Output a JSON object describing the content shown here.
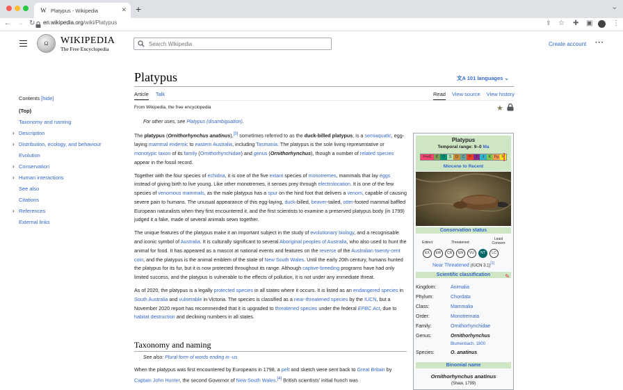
{
  "browser": {
    "tab_title": "Platypus - Wikipedia",
    "tab_favicon": "W",
    "url_host": "en.wikipedia.org",
    "url_path": "/wiki/Platypus"
  },
  "header": {
    "wordmark": "Wikipedia",
    "tagline": "The Free Encyclopedia",
    "search_placeholder": "Search Wikipedia",
    "create_account": "Create account"
  },
  "toc": {
    "title": "Contents",
    "hide": "[hide]",
    "items": [
      {
        "label": "(Top)",
        "expandable": false
      },
      {
        "label": "Taxonomy and naming",
        "expandable": false
      },
      {
        "label": "Description",
        "expandable": true
      },
      {
        "label": "Distribution, ecology, and behaviour",
        "expandable": true
      },
      {
        "label": "Evolution",
        "expandable": false
      },
      {
        "label": "Conservation",
        "expandable": true
      },
      {
        "label": "Human interactions",
        "expandable": true
      },
      {
        "label": "See also",
        "expandable": false
      },
      {
        "label": "Citations",
        "expandable": false
      },
      {
        "label": "References",
        "expandable": true
      },
      {
        "label": "External links",
        "expandable": false
      }
    ]
  },
  "article": {
    "title": "Platypus",
    "languages": "101 languages",
    "tab_article": "Article",
    "tab_talk": "Talk",
    "tab_read": "Read",
    "tab_view_source": "View source",
    "tab_view_history": "View history",
    "from": "From Wikipedia, the free encyclopedia",
    "hatnote_prefix": "For other uses, see ",
    "hatnote_link": "Platypus (disambiguation)",
    "hatnote_suffix": ".",
    "section1": "Taxonomy and naming",
    "see_also_prefix": "See also: ",
    "see_also_link": "Plural form of words ending in -us"
  },
  "infobox": {
    "name": "Platypus",
    "temporal_label": "Temporal range: 9–0",
    "temporal_unit": "Ma",
    "epochs": [
      "PreЄ",
      "Є",
      "O",
      "S",
      "D",
      "C",
      "P",
      "T",
      "J",
      "K",
      "Pg",
      "N"
    ],
    "epoch_colors": [
      "#f74370",
      "#7fa056",
      "#009270",
      "#b3e1b6",
      "#cb8c37",
      "#67a599",
      "#f04028",
      "#812b92",
      "#34b2c9",
      "#7fc64e",
      "#fd9a52",
      "#ffe619"
    ],
    "epoch_range": "Miocene to Recent",
    "conservation_status": "Conservation status",
    "status_extinct": "Extinct",
    "status_threatened": "Threatened",
    "status_least": "Least Concern",
    "status_codes": [
      "EX",
      "EW",
      "CR",
      "EN",
      "VU",
      "NT",
      "LC"
    ],
    "status_selected": "NT",
    "status_text": "Near Threatened",
    "status_source": "(IUCN 3.1)",
    "status_ref": "[1]",
    "sci_class": "Scientific classification",
    "taxonomy": [
      {
        "rank": "Kingdom:",
        "value": "Animalia"
      },
      {
        "rank": "Phylum:",
        "value": "Chordata"
      },
      {
        "rank": "Class:",
        "value": "Mammalia"
      },
      {
        "rank": "Order:",
        "value": "Monotremata"
      },
      {
        "rank": "Family:",
        "value": "Ornithorhynchidae"
      },
      {
        "rank": "Genus:",
        "value": "Ornithorhynchus"
      },
      {
        "rank": "",
        "value": "Blumenbach, 1800"
      },
      {
        "rank": "Species:",
        "value": "O. anatinus"
      }
    ],
    "binomial_name": "Binomial name",
    "binomial": "Ornithorhynchus anatinus",
    "binomial_author": "(Shaw, 1799)"
  },
  "colors": {
    "link": "#3366cc",
    "infobox_header": "#cfe6c5",
    "status_selected": "#006666"
  }
}
